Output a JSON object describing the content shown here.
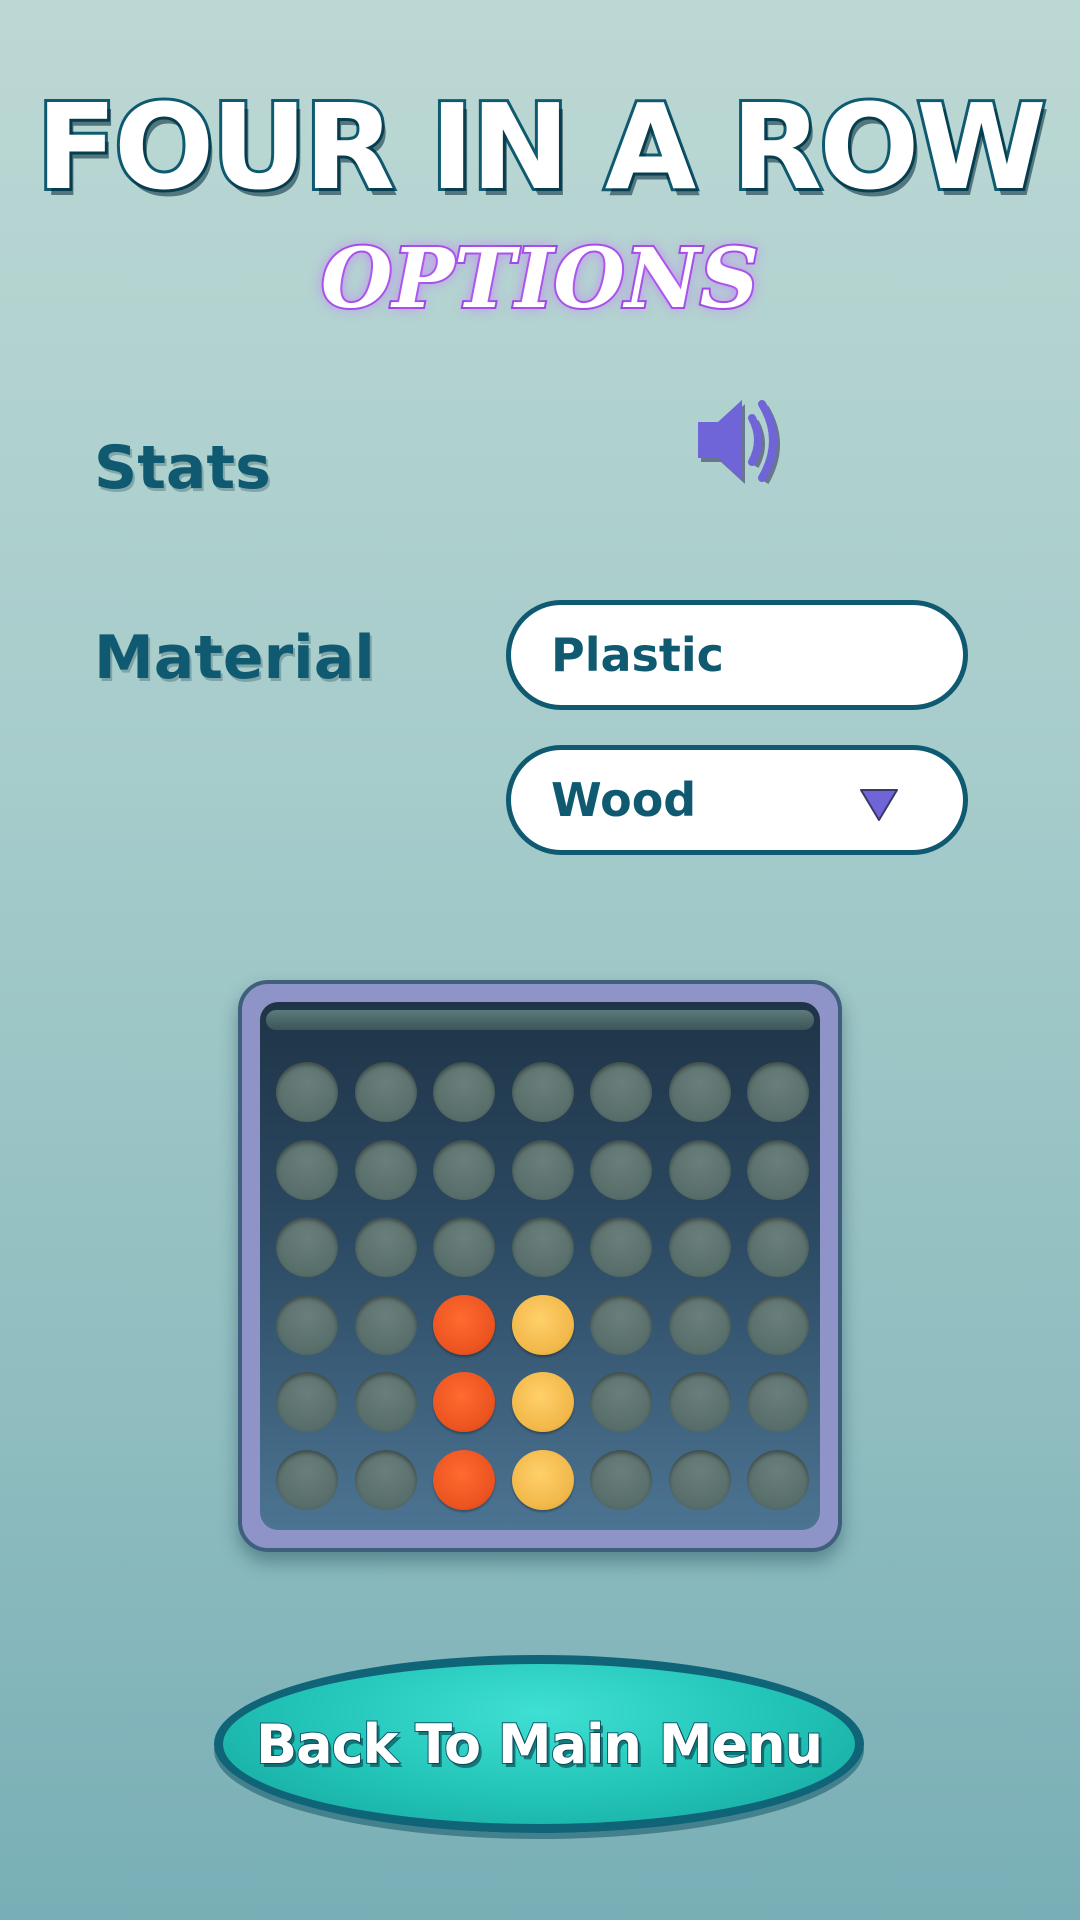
{
  "header": {
    "title": "FOUR IN A ROW",
    "subtitle": "OPTIONS"
  },
  "options": {
    "stats_label": "Stats",
    "sound_icon": "speaker-volume-icon",
    "material_label": "Material",
    "material_options": [
      "Plastic",
      "Wood"
    ],
    "dropdown_icon": "triangle-down-icon"
  },
  "board_preview": {
    "rows": 6,
    "columns": 7,
    "discs": [
      {
        "row": 4,
        "col": 3,
        "color": "red"
      },
      {
        "row": 5,
        "col": 3,
        "color": "red"
      },
      {
        "row": 6,
        "col": 3,
        "color": "red"
      },
      {
        "row": 4,
        "col": 4,
        "color": "yellow"
      },
      {
        "row": 5,
        "col": 4,
        "color": "yellow"
      },
      {
        "row": 6,
        "col": 4,
        "color": "yellow"
      }
    ]
  },
  "footer": {
    "back_label": "Back To Main Menu"
  },
  "colors": {
    "accent": "#0f5a70",
    "subtitle_glow": "#9a3fe0",
    "icon_purple": "#6f64d8",
    "button_teal": "#22c3b7",
    "disc_red": "#ec5420",
    "disc_yellow": "#f2b84a",
    "frame": "#8f94c8"
  }
}
